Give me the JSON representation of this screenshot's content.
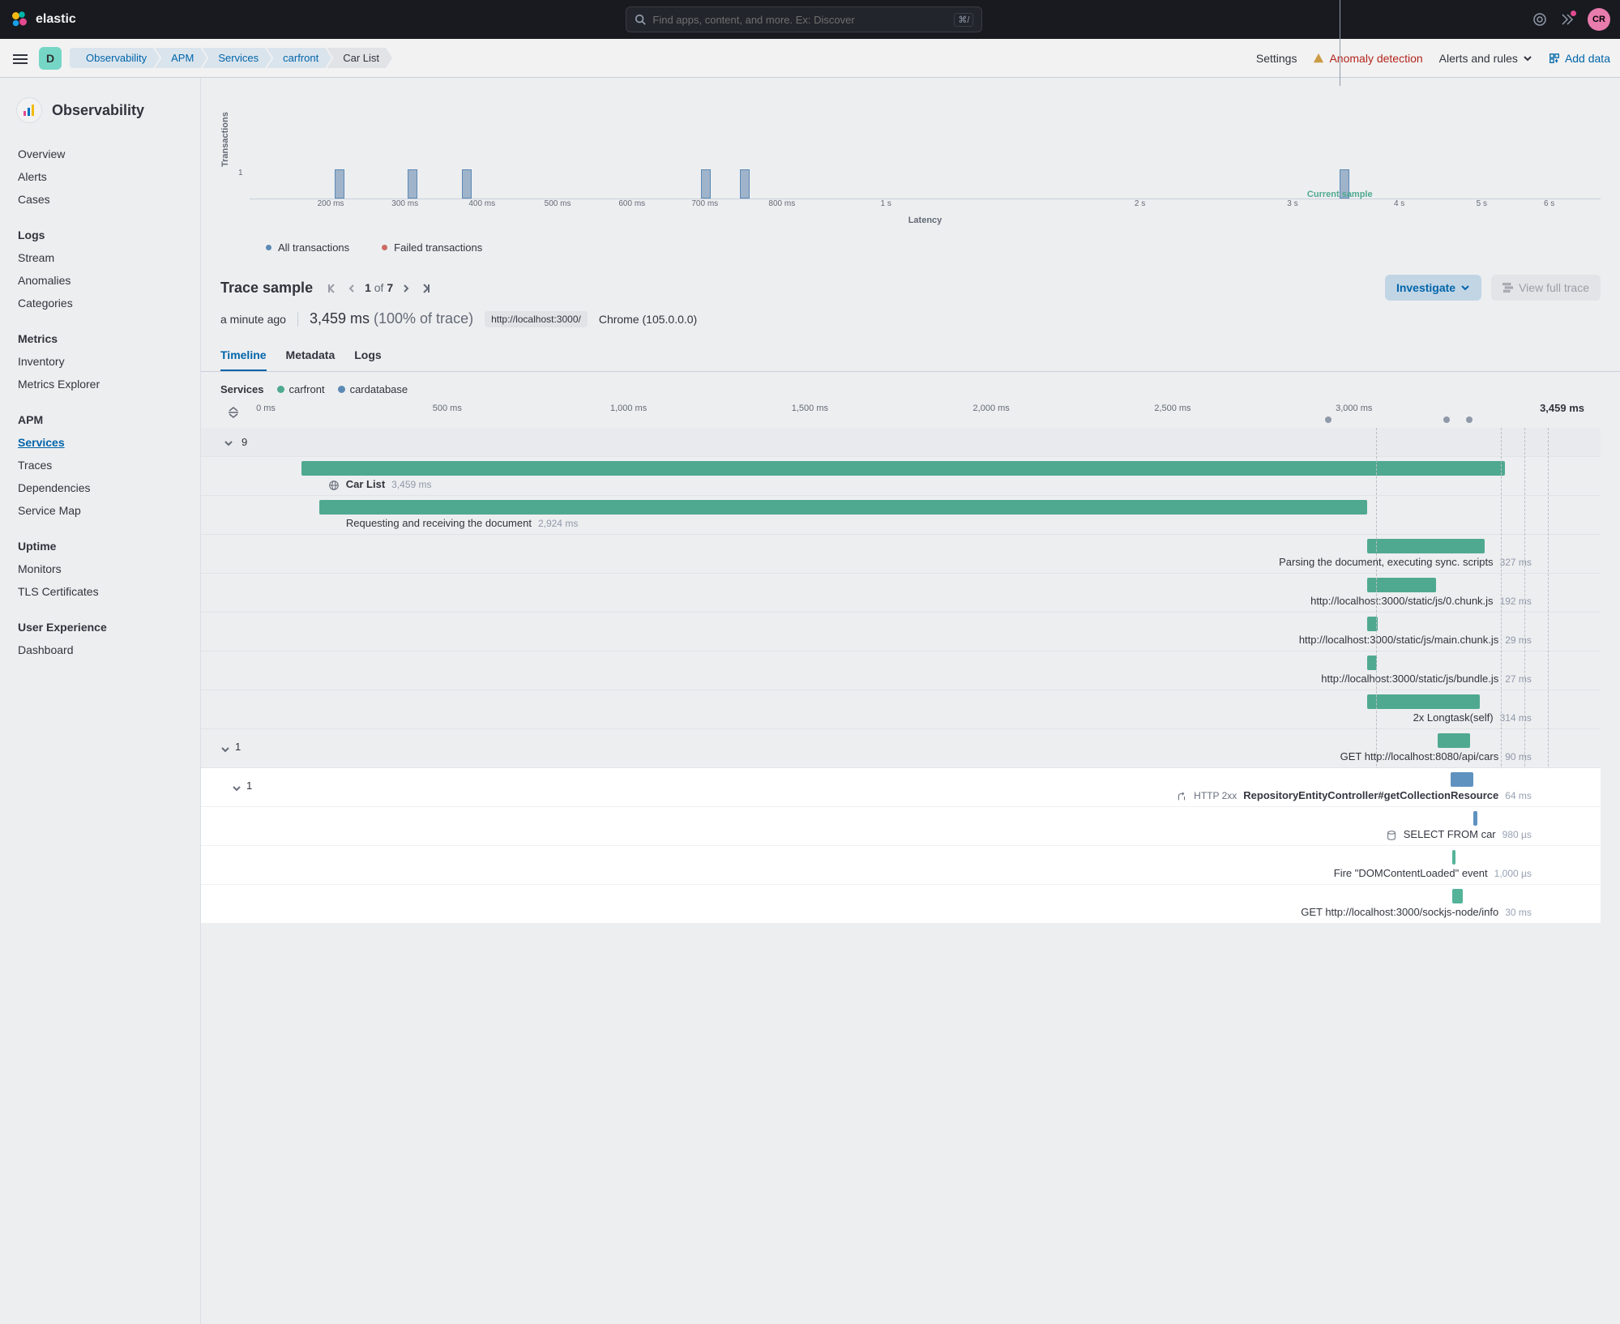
{
  "topbar": {
    "brand": "elastic",
    "search_placeholder": "Find apps, content, and more. Ex: Discover",
    "search_kbd": "⌘/",
    "avatar_initials": "CR"
  },
  "subheader": {
    "space_letter": "D",
    "breadcrumbs": [
      "Observability",
      "APM",
      "Services",
      "carfront",
      "Car List"
    ],
    "settings": "Settings",
    "anomaly": "Anomaly detection",
    "alerts": "Alerts and rules",
    "add_data": "Add data"
  },
  "sidebar": {
    "title": "Observability",
    "groups": [
      {
        "title": "",
        "items": [
          "Overview",
          "Alerts",
          "Cases"
        ]
      },
      {
        "title": "Logs",
        "items": [
          "Stream",
          "Anomalies",
          "Categories"
        ]
      },
      {
        "title": "Metrics",
        "items": [
          "Inventory",
          "Metrics Explorer"
        ]
      },
      {
        "title": "APM",
        "items": [
          "Services",
          "Traces",
          "Dependencies",
          "Service Map"
        ]
      },
      {
        "title": "Uptime",
        "items": [
          "Monitors",
          "TLS Certificates"
        ]
      },
      {
        "title": "User Experience",
        "items": [
          "Dashboard"
        ]
      }
    ],
    "active": "Services"
  },
  "latency_chart": {
    "ylabel": "Transactions",
    "ymax_tick": "1",
    "xlabel": "Latency",
    "ticks": [
      "200 ms",
      "300 ms",
      "400 ms",
      "500 ms",
      "600 ms",
      "700 ms",
      "800 ms",
      "1 s",
      "2 s",
      "3 s",
      "4 s",
      "5 s",
      "6 s"
    ],
    "tick_pos": [
      6.0,
      11.5,
      17.2,
      22.8,
      28.3,
      33.7,
      39.4,
      47.1,
      65.9,
      77.2,
      85.1,
      91.2,
      96.2
    ],
    "bars_pos": [
      6.3,
      11.7,
      15.7,
      33.4,
      36.3,
      80.7
    ],
    "marker_pos": 80.7,
    "marker_label": "Current sample",
    "legend": [
      {
        "label": "All transactions",
        "color": "#6092c0"
      },
      {
        "label": "Failed transactions",
        "color": "#d6726a"
      }
    ]
  },
  "trace": {
    "title": "Trace sample",
    "page_current": "1",
    "page_of": "of",
    "page_total": "7",
    "investigate": "Investigate",
    "view_full": "View full trace",
    "timeago": "a minute ago",
    "duration": "3,459 ms",
    "pct": "(100% of trace)",
    "url": "http://localhost:3000/",
    "browser": "Chrome (105.0.0.0)",
    "tabs": [
      "Timeline",
      "Metadata",
      "Logs"
    ],
    "active_tab": "Timeline"
  },
  "timeline": {
    "services_label": "Services",
    "services": [
      {
        "name": "carfront",
        "color": "#54b399"
      },
      {
        "name": "cardatabase",
        "color": "#6092c0"
      }
    ],
    "ticks": [
      "0 ms",
      "500 ms",
      "1,000 ms",
      "1,500 ms",
      "2,000 ms",
      "2,500 ms",
      "3,000 ms"
    ],
    "total": "3,459 ms"
  },
  "spans": {
    "group1_count": "9",
    "group2_count": "1",
    "group3_count": "1",
    "rows": [
      {
        "label": "Car List",
        "dur": "3,459 ms",
        "icon": "globe",
        "bold": true
      },
      {
        "label": "Requesting and receiving the document",
        "dur": "2,924 ms"
      },
      {
        "label": "Parsing the document, executing sync. scripts",
        "dur": "327 ms"
      },
      {
        "label": "http://localhost:3000/static/js/0.chunk.js",
        "dur": "192 ms"
      },
      {
        "label": "http://localhost:3000/static/js/main.chunk.js",
        "dur": "29 ms"
      },
      {
        "label": "http://localhost:3000/static/js/bundle.js",
        "dur": "27 ms"
      },
      {
        "label": "2x Longtask(self)",
        "dur": "314 ms"
      },
      {
        "label": "GET http://localhost:8080/api/cars",
        "dur": "90 ms"
      },
      {
        "label": "RepositoryEntityController#getCollectionResource",
        "dur": "64 ms",
        "http": "HTTP 2xx",
        "icon": "merge",
        "bold": true
      },
      {
        "label": "SELECT FROM car",
        "dur": "980 µs",
        "icon": "db"
      },
      {
        "label": "Fire \"DOMContentLoaded\" event",
        "dur": "1,000 µs"
      },
      {
        "label": "GET http://localhost:3000/sockjs-node/info",
        "dur": "30 ms"
      }
    ]
  },
  "colors": {
    "green": "#54b399",
    "blue": "#6092c0"
  }
}
